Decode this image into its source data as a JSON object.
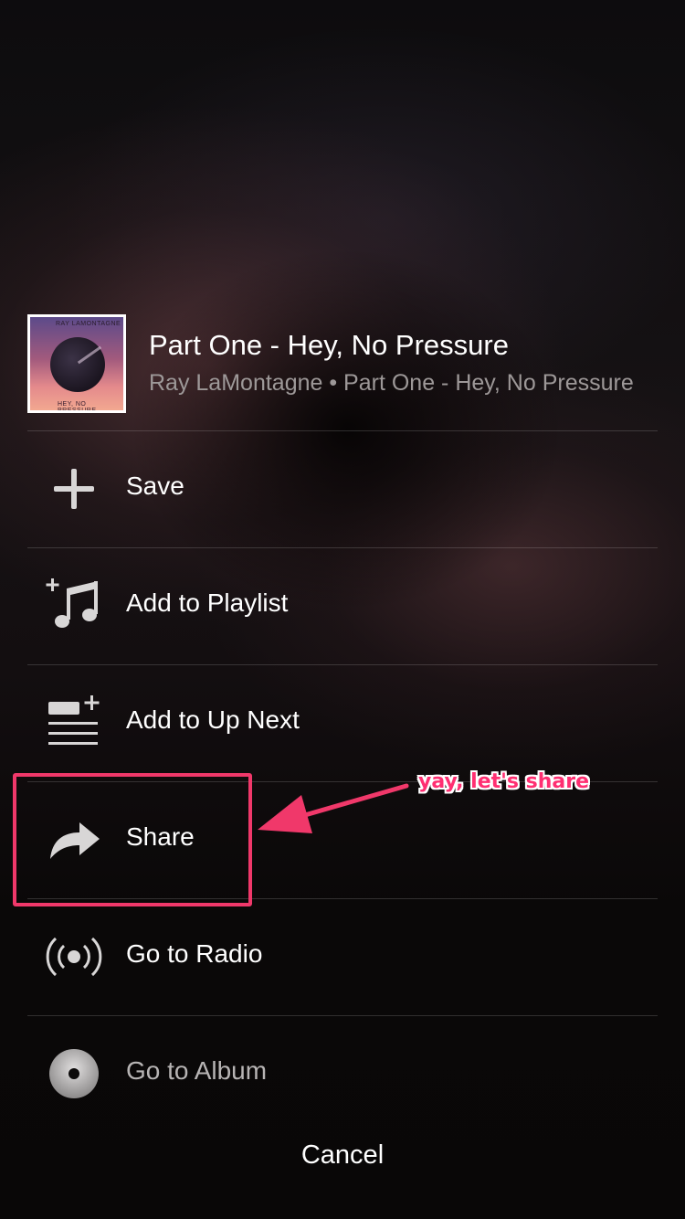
{
  "header": {
    "album_art_label": "album-art",
    "album_art_text_top": "RAY LAMONTAGNE",
    "album_art_text_bottom": "HEY, NO PRESSURE",
    "title": "Part One - Hey, No Pressure",
    "subtitle": "Ray LaMontagne • Part One - Hey, No Pressure"
  },
  "menu": [
    {
      "label": "Save",
      "icon": "plus-icon"
    },
    {
      "label": "Add to Playlist",
      "icon": "music-note-plus-icon"
    },
    {
      "label": "Add to Up Next",
      "icon": "queue-add-icon"
    },
    {
      "label": "Share",
      "icon": "share-arrow-icon"
    },
    {
      "label": "Go to Radio",
      "icon": "radio-broadcast-icon"
    },
    {
      "label": "Go to Album",
      "icon": "album-disc-icon"
    }
  ],
  "cancel_label": "Cancel",
  "annotation": {
    "text": "yay, let's share",
    "color": "#f0386a"
  }
}
